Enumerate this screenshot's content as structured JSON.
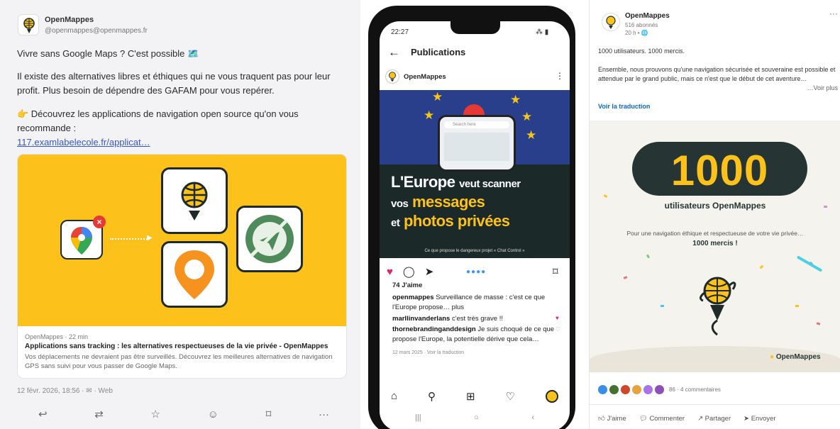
{
  "mastodon": {
    "name": "OpenMappes",
    "handle": "@openmappes@openmappes.fr",
    "line1": "Vivre sans Google Maps ? C'est possible 🗺️",
    "line2": "Il existe des alternatives libres et éthiques qui ne vous traquent pas pour leur profit. Plus besoin de dépendre des GAFAM pour vous repérer.",
    "line3": "👉 Découvrez les applications de navigation open source qu'on vous recommande :",
    "link": "117.examlabelecole.fr/applicat…",
    "card_source": "OpenMappes · 22 min",
    "card_title": "Applications sans tracking : les alternatives respectueuses de la vie privée - OpenMappes",
    "card_desc": "Vos déplacements ne devraient pas être surveillés. Découvrez les meilleures alternatives de navigation GPS sans suivi pour vous passer de Google Maps.",
    "footer": "12 févr. 2026, 18:56 · ✉ · Web",
    "accent": "#fcc21b"
  },
  "instagram": {
    "time": "22:27",
    "signal": "⁂ ▮",
    "title": "Publications",
    "account": "OpenMappes",
    "search_placeholder": "Search here",
    "headline_1": "L'Europe",
    "headline_1b": "veut scanner",
    "headline_2": "vos",
    "headline_2b": "messages",
    "headline_3": "et",
    "headline_3b": "photos privées",
    "post_caption": "Ce que propose le dangereux projet « Chat Control »",
    "likes": "74 J'aime",
    "caption_user": "openmappes",
    "caption_text": "Surveillance de masse : c'est ce que l'Europe propose… plus",
    "comment1_user": "marllinvanderlans",
    "comment1_text": "c'est très grave !!",
    "comment2_user": "thornebrandinganddesign",
    "comment2_text": "Je suis choqué de ce que propose l'Europe, la potentielle dérive que cela…",
    "date_line": "12 mars 2025 · Voir la traduction"
  },
  "linkedin": {
    "name": "OpenMappes",
    "followers": "516 abonnés",
    "time": "20 h • 🌐",
    "line1": "1000 utilisateurs. 1000 mercis.",
    "line2": "Ensemble, nous prouvons qu'une navigation sécurisée et souveraine est possible et attendue par le grand public, mais ce n'est que le début de cet aventure…",
    "see_more": "…Voir plus",
    "translate": "Voir la traduction",
    "big_number": "1000",
    "big_label": "utilisateurs OpenMappes",
    "img_sub": "Pour une navigation éthique et respectueuse de votre vie privée…",
    "img_thanks": "1000 mercis !",
    "brand": "OpenMappes",
    "reactions": "86 · 4 commentaires",
    "like": "J'aime",
    "comment": "Commenter",
    "share": "Partager",
    "send": "Envoyer"
  }
}
